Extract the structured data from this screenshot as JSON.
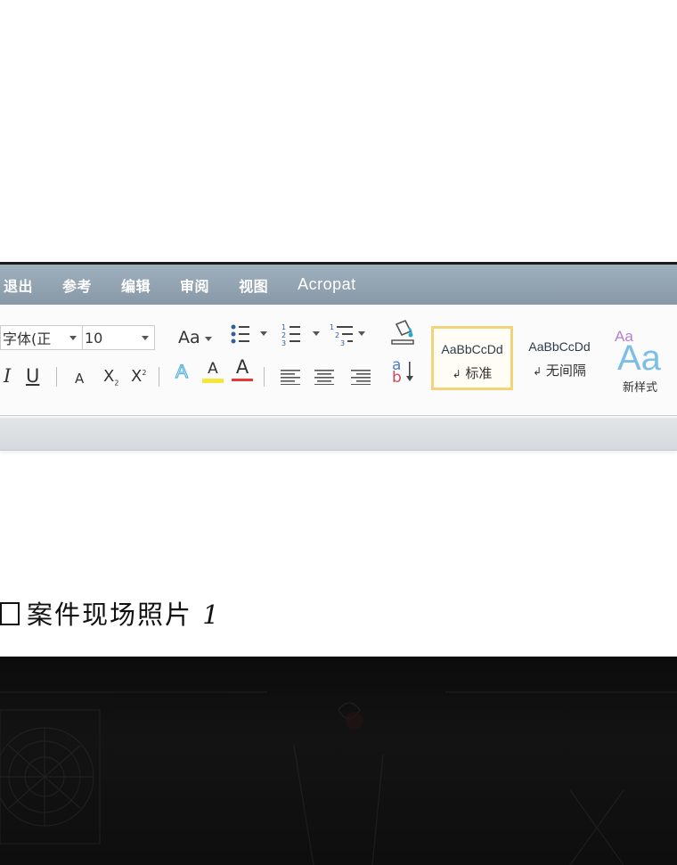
{
  "menu": {
    "items": [
      "退出",
      "参考",
      "编辑",
      "审阅",
      "视图"
    ],
    "brand": "Acropat"
  },
  "font": {
    "family": "字体(正",
    "size": "10"
  },
  "toolbar": {
    "change_case": "Aa",
    "italic": "I",
    "underline": "U",
    "clear_format": "A",
    "subscript": "X",
    "subscript_mark": "2",
    "superscript": "X",
    "superscript_mark": "2",
    "text_effect": "A",
    "highlight": "A",
    "font_color": "A",
    "sort_top": "a",
    "sort_bottom": "b"
  },
  "styles": [
    {
      "sample": "AaBbCcDd",
      "name": "标准",
      "selected": true
    },
    {
      "sample": "AaBbCcDd",
      "name": "无间隔",
      "selected": false
    }
  ],
  "new_style": {
    "small": "Aa",
    "big": "Aa",
    "label": "新样式"
  },
  "caption": {
    "text": "案件现场照片",
    "number": "1"
  },
  "colors": {
    "menubar": "#95a6b4",
    "highlight": "#f5e63a",
    "font_color": "#e53935",
    "selected_style_border": "#f3d37a",
    "new_style_blue": "#7bbfe6",
    "new_style_purple": "#b77fd1"
  }
}
